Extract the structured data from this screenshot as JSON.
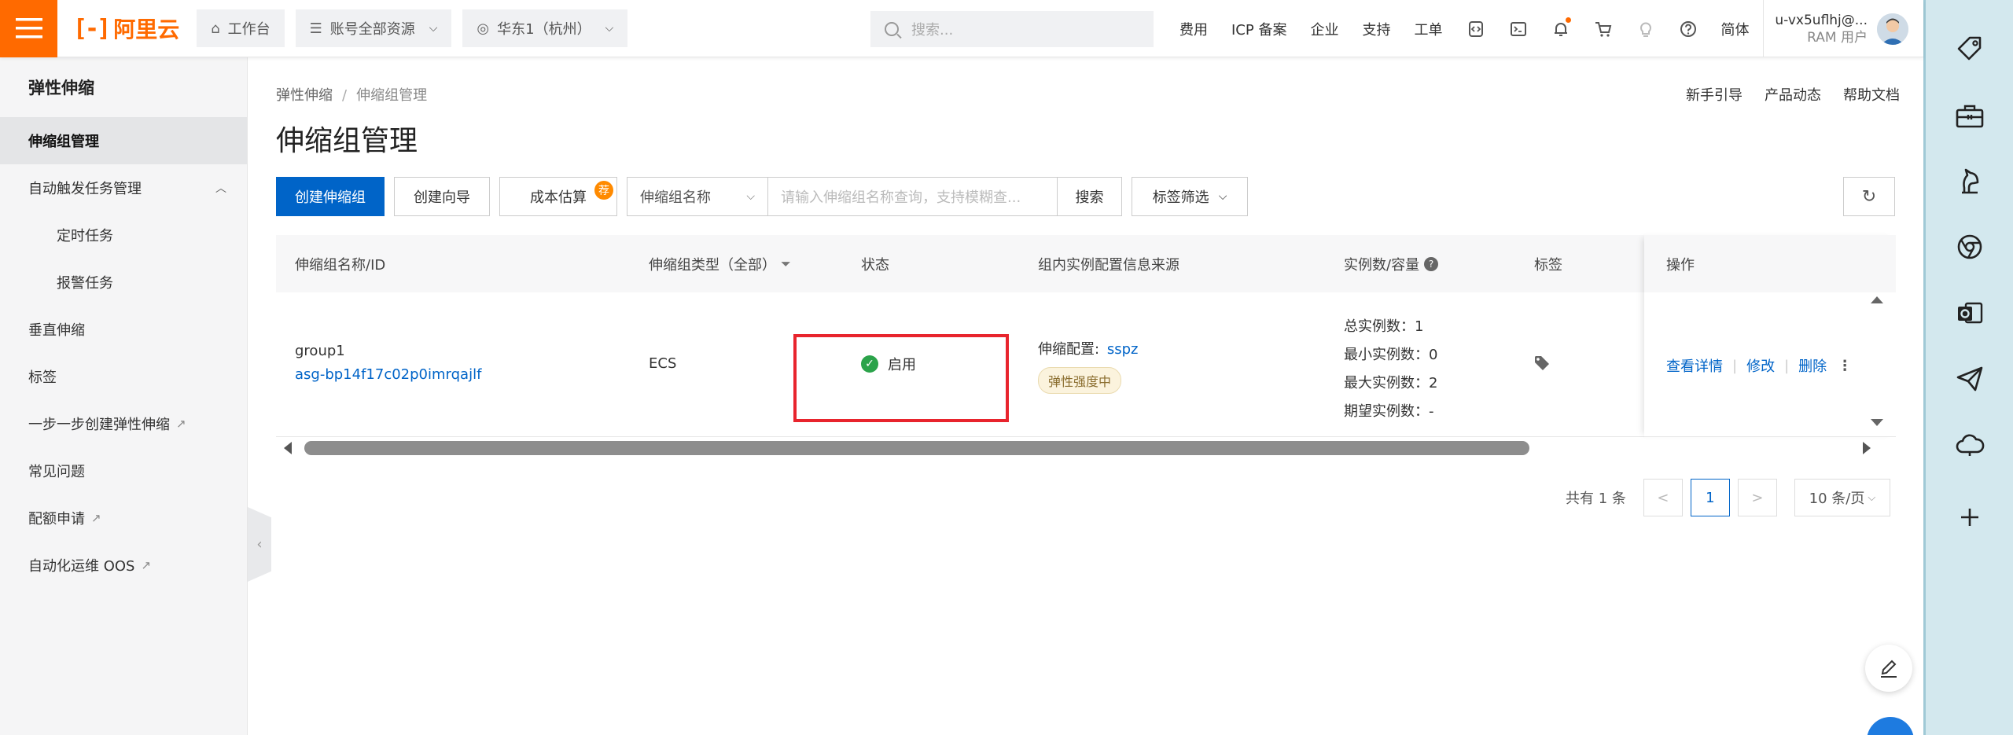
{
  "brand": {
    "logo_text": "阿里云",
    "logo_bracket": "[-]"
  },
  "topbar": {
    "workbench": "工作台",
    "resources": "账号全部资源",
    "region": "华东1（杭州）",
    "search_placeholder": "搜索...",
    "links": [
      "费用",
      "ICP 备案",
      "企业",
      "支持",
      "工单"
    ],
    "lang": "简体",
    "user_name": "u-vx5uflhj@...",
    "user_role": "RAM 用户"
  },
  "sidebar": {
    "title": "弹性伸缩",
    "items": [
      {
        "label": "伸缩组管理"
      },
      {
        "label": "自动触发任务管理"
      },
      {
        "label": "定时任务"
      },
      {
        "label": "报警任务"
      },
      {
        "label": "垂直伸缩"
      },
      {
        "label": "标签"
      },
      {
        "label": "一步一步创建弹性伸缩"
      },
      {
        "label": "常见问题"
      },
      {
        "label": "配额申请"
      },
      {
        "label": "自动化运维 OOS"
      }
    ]
  },
  "breadcrumb": {
    "root": "弹性伸缩",
    "sep": "/",
    "current": "伸缩组管理"
  },
  "help_links": [
    "新手引导",
    "产品动态",
    "帮助文档"
  ],
  "page_title": "伸缩组管理",
  "toolbar": {
    "create": "创建伸缩组",
    "wizard": "创建向导",
    "cost": "成本估算",
    "cost_badge": "荐",
    "filter_select": "伸缩组名称",
    "filter_placeholder": "请输入伸缩组名称查询，支持模糊查...",
    "search": "搜索",
    "tag_filter": "标签筛选"
  },
  "table": {
    "headers": [
      "伸缩组名称/ID",
      "伸缩组类型（全部）",
      "状态",
      "组内实例配置信息来源",
      "实例数/容量",
      "标签",
      "操作"
    ],
    "row": {
      "name": "group1",
      "id": "asg-bp14f17c02p0imrqajlf",
      "type": "ECS",
      "status": "启用",
      "config_label": "伸缩配置:",
      "config_value": "sspz",
      "strength": "弹性强度中",
      "total": "总实例数：1",
      "min": "最小实例数：0",
      "max": "最大实例数：2",
      "desired": "期望实例数：-",
      "ops": [
        "查看详情",
        "修改",
        "删除"
      ]
    }
  },
  "pagination": {
    "total": "共有 1 条",
    "prev": "<",
    "page": "1",
    "next": ">",
    "page_size": "10 条/页"
  },
  "colors": {
    "accent": "#ff6a00",
    "primary": "#0064c8",
    "success": "#2ba34a",
    "highlight": "#e8242d",
    "rail": "#d3e8ee"
  }
}
